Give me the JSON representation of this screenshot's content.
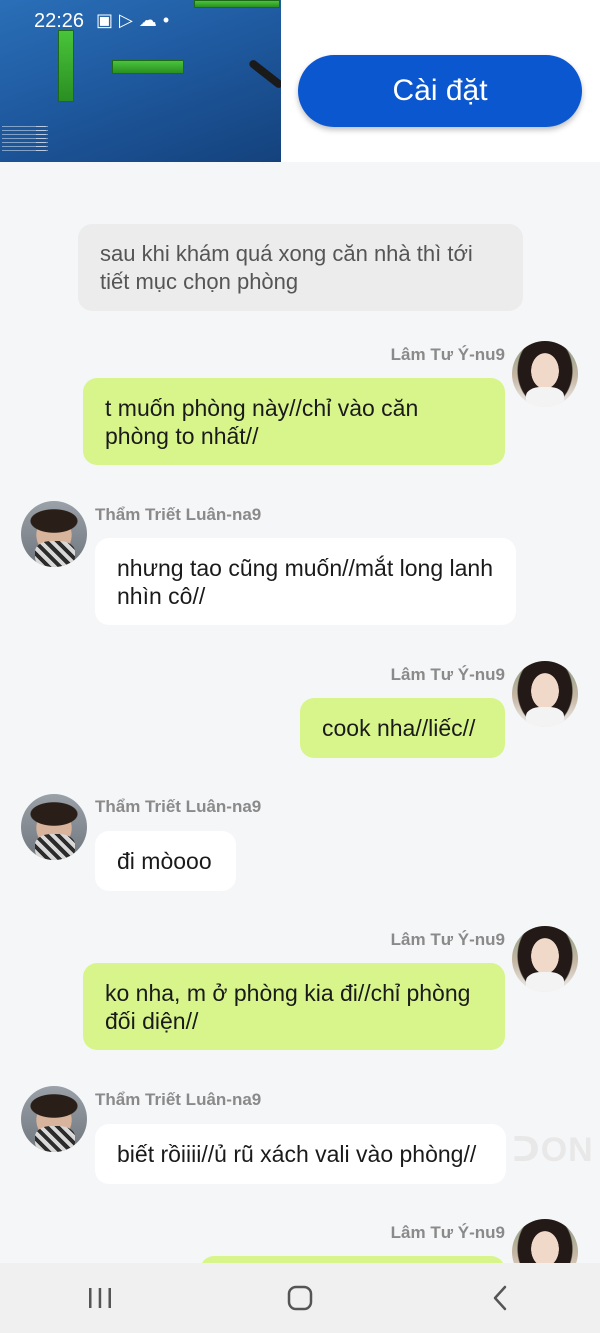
{
  "status_bar": {
    "time": "22:26",
    "icons": [
      "image-icon",
      "play-icon",
      "cloud-icon",
      "dot-icon"
    ]
  },
  "ad": {
    "install_label": "Cài đặt",
    "button_color": "#0b57d0"
  },
  "chat": {
    "narration": "sau khi khám quá xong căn nhà thì tới tiết mục chọn phòng",
    "messages": [
      {
        "sender": "Lâm Tư Ý-nu9",
        "side": "right",
        "text": "t muốn phòng này//chỉ vào căn phòng to nhất//"
      },
      {
        "sender": "Thẩm Triết Luân-na9",
        "side": "left",
        "text": "nhưng tao cũng muốn//mắt long lanh nhìn cô//"
      },
      {
        "sender": "Lâm Tư Ý-nu9",
        "side": "right",
        "text": "cook nha//liếc//"
      },
      {
        "sender": "Thẩm Triết Luân-na9",
        "side": "left",
        "text": "đi mòooo"
      },
      {
        "sender": "Lâm Tư Ý-nu9",
        "side": "right",
        "text": "ko nha, m ở phòng kia đi//chỉ phòng đối diện//"
      },
      {
        "sender": "Thẩm Triết Luân-na9",
        "side": "left",
        "text": "biết rồiiii//ủ rũ xách vali vào phòng//"
      },
      {
        "sender": "Lâm Tư Ý-nu9",
        "side": "right",
        "text": ""
      }
    ]
  },
  "colors": {
    "right_bubble": "#d8f58c",
    "left_bubble": "#ffffff",
    "background": "#f5f6f8"
  },
  "nav": {
    "buttons": [
      "recent-apps-icon",
      "home-icon",
      "back-icon"
    ]
  }
}
